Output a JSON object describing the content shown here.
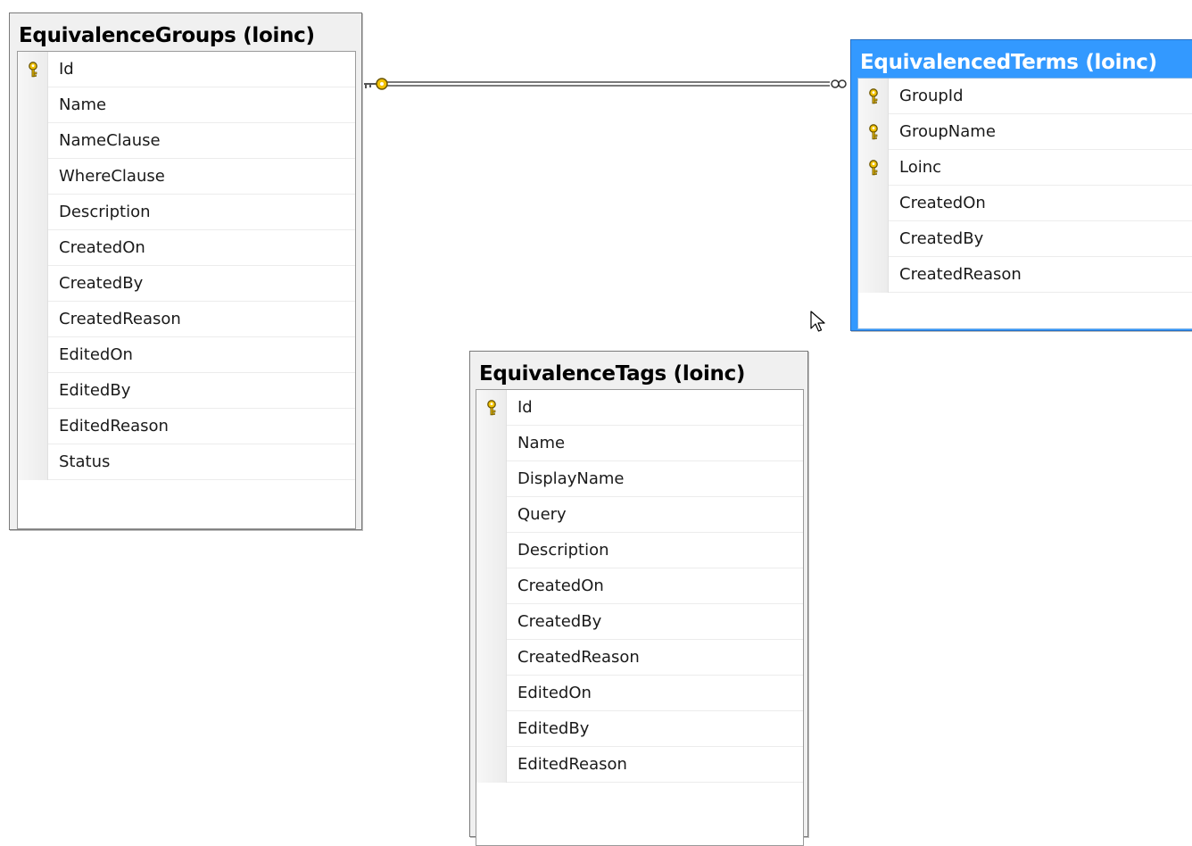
{
  "tables": [
    {
      "id": "groups",
      "name": "EquivalenceGroups (loinc)",
      "selected": false,
      "columns": [
        {
          "name": "Id",
          "key": true
        },
        {
          "name": "Name",
          "key": false
        },
        {
          "name": "NameClause",
          "key": false
        },
        {
          "name": "WhereClause",
          "key": false
        },
        {
          "name": "Description",
          "key": false
        },
        {
          "name": "CreatedOn",
          "key": false
        },
        {
          "name": "CreatedBy",
          "key": false
        },
        {
          "name": "CreatedReason",
          "key": false
        },
        {
          "name": "EditedOn",
          "key": false
        },
        {
          "name": "EditedBy",
          "key": false
        },
        {
          "name": "EditedReason",
          "key": false
        },
        {
          "name": "Status",
          "key": false
        }
      ]
    },
    {
      "id": "terms",
      "name": "EquivalencedTerms (loinc)",
      "selected": true,
      "columns": [
        {
          "name": "GroupId",
          "key": true
        },
        {
          "name": "GroupName",
          "key": true
        },
        {
          "name": "Loinc",
          "key": true
        },
        {
          "name": "CreatedOn",
          "key": false
        },
        {
          "name": "CreatedBy",
          "key": false
        },
        {
          "name": "CreatedReason",
          "key": false
        }
      ]
    },
    {
      "id": "tags",
      "name": "EquivalenceTags (loinc)",
      "selected": false,
      "columns": [
        {
          "name": "Id",
          "key": true
        },
        {
          "name": "Name",
          "key": false
        },
        {
          "name": "DisplayName",
          "key": false
        },
        {
          "name": "Query",
          "key": false
        },
        {
          "name": "Description",
          "key": false
        },
        {
          "name": "CreatedOn",
          "key": false
        },
        {
          "name": "CreatedBy",
          "key": false
        },
        {
          "name": "CreatedReason",
          "key": false
        },
        {
          "name": "EditedOn",
          "key": false
        },
        {
          "name": "EditedBy",
          "key": false
        },
        {
          "name": "EditedReason",
          "key": false
        }
      ]
    }
  ],
  "relationship": {
    "from": "EquivalenceGroups (loinc)",
    "to": "EquivalencedTerms (loinc)",
    "from_end": "one",
    "to_end": "many"
  },
  "colors": {
    "selected_header": "#3399ff",
    "key_icon": "#f2c200",
    "relationship_line": "#7a7a7a"
  },
  "icons": {
    "key": "key-icon",
    "cursor": "mouse-pointer-icon"
  }
}
